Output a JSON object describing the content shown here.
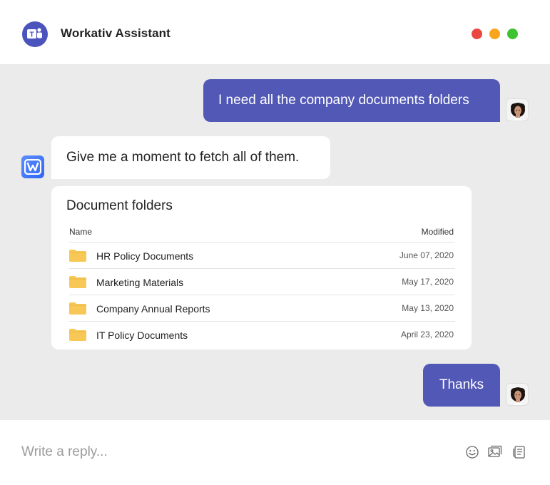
{
  "header": {
    "app_icon": "teams-icon",
    "title": "Workativ Assistant",
    "window_controls": [
      {
        "name": "close",
        "color": "#e8483f"
      },
      {
        "name": "minimize",
        "color": "#f7a51c"
      },
      {
        "name": "maximize",
        "color": "#3ec231"
      }
    ]
  },
  "messages": {
    "user_1": "I need all the company documents folders",
    "bot_1": "Give me a moment to fetch all of them.",
    "user_2": "Thanks"
  },
  "documents": {
    "title": "Document folders",
    "columns": {
      "name": "Name",
      "modified": "Modified"
    },
    "rows": [
      {
        "name": "HR Policy Documents",
        "modified": "June 07, 2020",
        "icon": "folder-icon"
      },
      {
        "name": "Marketing Materials",
        "modified": "May 17, 2020",
        "icon": "folder-icon"
      },
      {
        "name": "Company Annual Reports",
        "modified": "May 13, 2020",
        "icon": "folder-icon"
      },
      {
        "name": "IT Policy Documents",
        "modified": "April 23, 2020",
        "icon": "folder-icon"
      }
    ]
  },
  "composer": {
    "placeholder": "Write a reply...",
    "icons": [
      "emoji-icon",
      "image-icon",
      "attachment-icon"
    ]
  },
  "colors": {
    "user_bubble": "#5258b5",
    "chat_background": "#ebebeb",
    "folder": "#f7c855"
  }
}
